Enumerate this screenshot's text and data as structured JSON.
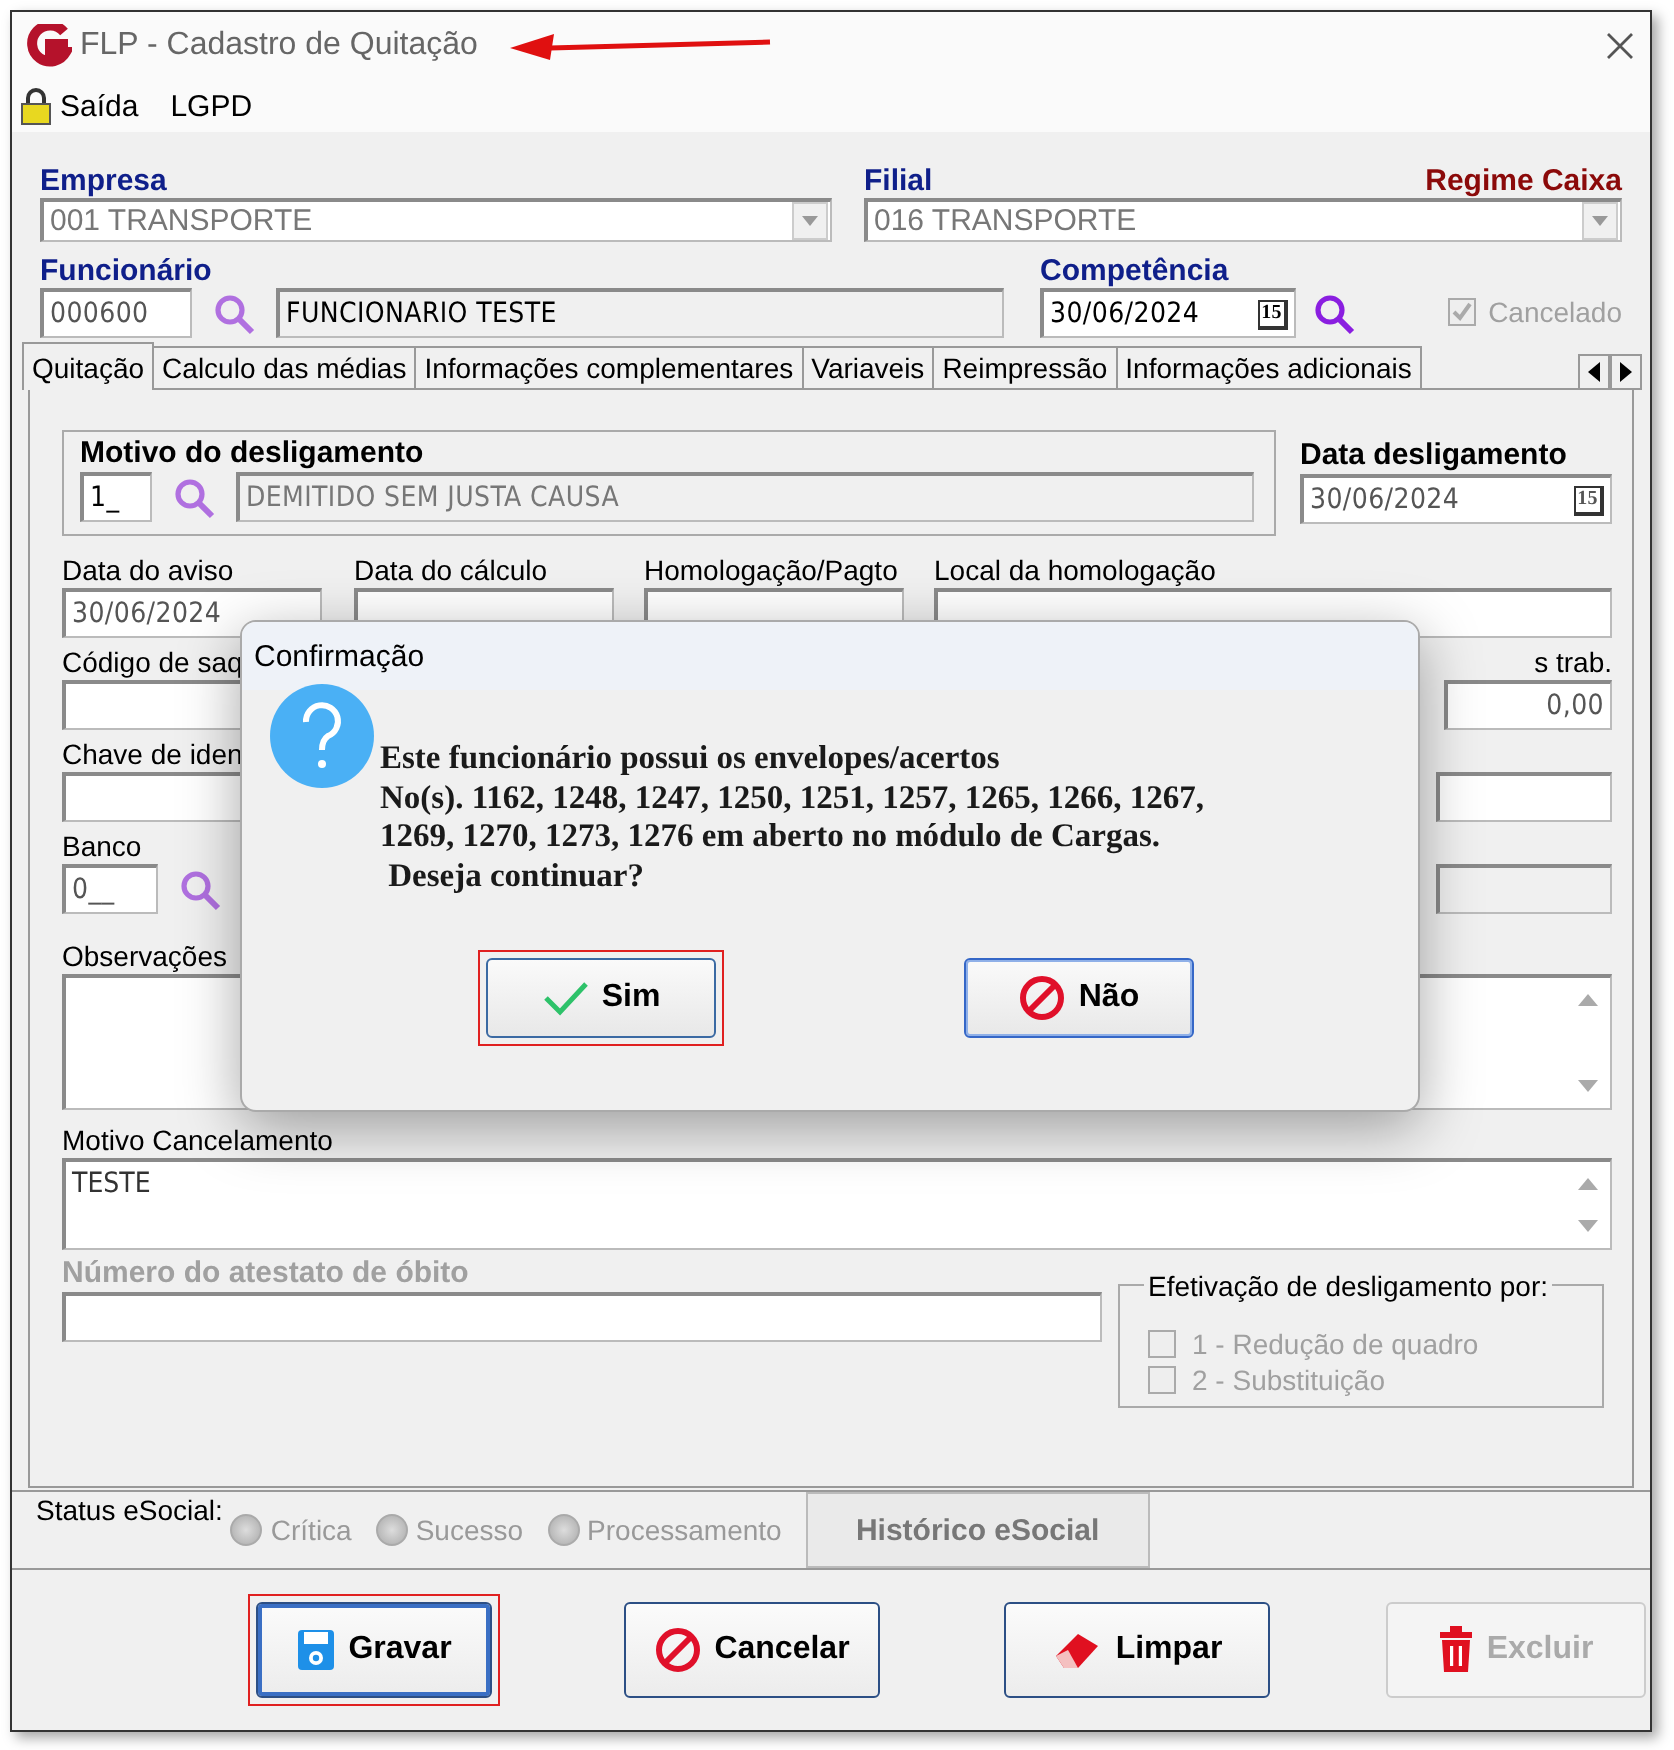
{
  "window": {
    "title": "FLP - Cadastro de Quitação"
  },
  "menu": [
    {
      "kind": "lock",
      "label": "Saída"
    },
    {
      "kind": "plain",
      "label": "LGPD"
    }
  ],
  "header": {
    "empresa": {
      "label": "Empresa",
      "value": "001 TRANSPORTE"
    },
    "filial": {
      "label": "Filial",
      "value": "016 TRANSPORTE"
    },
    "regime": "Regime Caixa",
    "funcionario": {
      "label": "Funcionário",
      "code": "000600",
      "name": "FUNCIONARIO TESTE"
    },
    "competencia": {
      "label": "Competência",
      "value": "30/06/2024",
      "calendar": "15"
    },
    "cancelado": {
      "label": "Cancelado",
      "checked": true,
      "disabled": true
    }
  },
  "tabs": [
    {
      "label": "Quitação",
      "selected": true
    },
    {
      "label": "Calculo das médias",
      "selected": false
    },
    {
      "label": "Informações complementares",
      "selected": false
    },
    {
      "label": "Variaveis",
      "selected": false
    },
    {
      "label": "Reimpressão",
      "selected": false
    },
    {
      "label": "Informações adicionais",
      "selected": false
    }
  ],
  "form": {
    "motivo": {
      "label": "Motivo do desligamento",
      "code": "1_",
      "description": "DEMITIDO SEM JUSTA CAUSA"
    },
    "data_desligamento": {
      "label": "Data desligamento",
      "value": "30/06/2024",
      "calendar": "15"
    },
    "data_aviso": {
      "label": "Data do aviso",
      "value": "30/06/2024"
    },
    "data_calculo": {
      "label": "Data do cálculo"
    },
    "homologacao": {
      "label": "Homologação/Pagto"
    },
    "local": {
      "label": "Local da homologação"
    },
    "codigo_saque": {
      "label": "Código de saq"
    },
    "column_right": {
      "label": "s trab.",
      "value": "0,00"
    },
    "chave": {
      "label": "Chave de iden"
    },
    "banco": {
      "label": "Banco",
      "code": "0__"
    },
    "observacoes": {
      "label": "Observações"
    },
    "motivo_cancelamento": {
      "label": "Motivo Cancelamento",
      "value": "TESTE"
    },
    "atestado": {
      "label": "Número do atestato de óbito",
      "disabled": true
    },
    "efetivacao": {
      "label": "Efetivação de desligamento por:",
      "options": [
        {
          "label": "1 - Redução de quadro",
          "checked": false,
          "disabled": true
        },
        {
          "label": "2 - Substituição",
          "checked": false,
          "disabled": true
        }
      ]
    }
  },
  "status": {
    "label": "Status eSocial:",
    "options": [
      {
        "label": "Crítica",
        "selected": false
      },
      {
        "label": "Sucesso",
        "selected": false
      },
      {
        "label": "Processamento",
        "selected": false
      }
    ],
    "history": "Histórico eSocial"
  },
  "buttons": [
    {
      "kind": "save",
      "label": "Gravar",
      "highlighted": true,
      "disabled": false
    },
    {
      "kind": "cancel",
      "label": "Cancelar",
      "highlighted": false,
      "disabled": false
    },
    {
      "kind": "clear",
      "label": "Limpar",
      "highlighted": false,
      "disabled": false
    },
    {
      "kind": "delete",
      "label": "Excluir",
      "highlighted": false,
      "disabled": true
    }
  ],
  "dialog": {
    "title": "Confirmação",
    "lines": [
      "Este funcionário possui os envelopes/acertos",
      "No(s). 1162, 1248, 1247, 1250, 1251, 1257, 1265, 1266, 1267,",
      "1269, 1270, 1273, 1276 em aberto no módulo de Cargas.",
      " Deseja continuar?"
    ],
    "buttons": [
      {
        "kind": "yes",
        "label": "Sim",
        "highlighted": true
      },
      {
        "kind": "no",
        "label": "Não",
        "highlighted": false
      }
    ]
  }
}
